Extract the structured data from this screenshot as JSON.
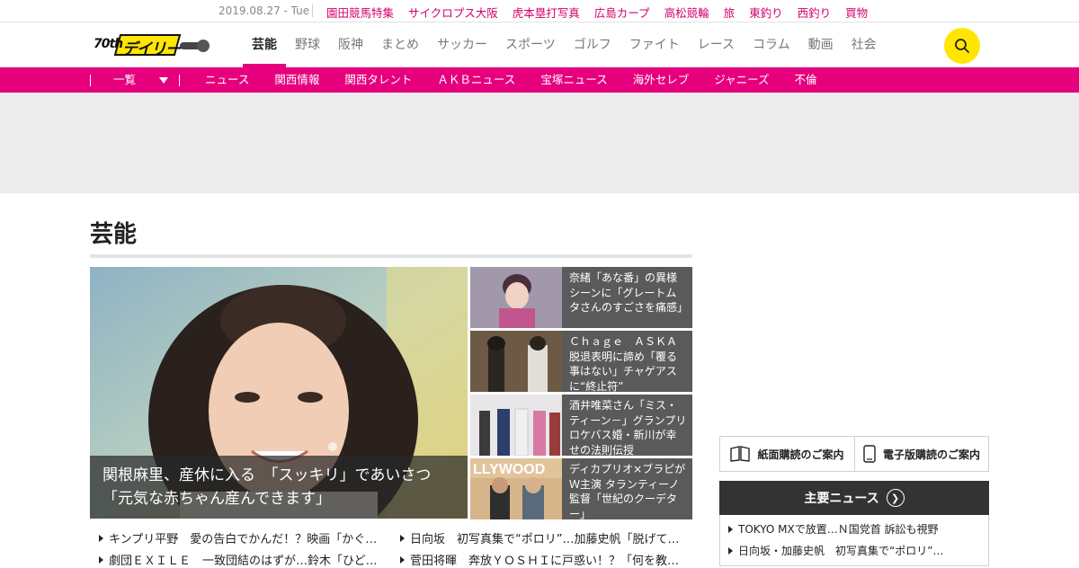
{
  "topbar": {
    "date": "2019.08.27 - Tue",
    "links": [
      "園田競馬特集",
      "サイクロプス大阪",
      "虎本塁打写真",
      "広島カープ",
      "高松競輪",
      "旅",
      "東釣り",
      "西釣り",
      "買物"
    ]
  },
  "header": {
    "logo_text": "デイリー",
    "logo_badge": "70th",
    "nav": [
      "芸能",
      "野球",
      "阪神",
      "まとめ",
      "サッカー",
      "スポーツ",
      "ゴルフ",
      "ファイト",
      "レース",
      "コラム",
      "動画",
      "社会"
    ],
    "active_nav": "芸能"
  },
  "subnav": {
    "list_label": "一覧",
    "links": [
      "ニュース",
      "関西情報",
      "関西タレント",
      "ＡＫＢニュース",
      "宝塚ニュース",
      "海外セレブ",
      "ジャニーズ",
      "不倫"
    ]
  },
  "page": {
    "title": "芸能"
  },
  "hero": {
    "caption": "関根麻里、産休に入る　「スッキリ」であいさつ「元気な赤ちゃん産んできます」"
  },
  "side_stories": [
    {
      "text": "奈緒「あな番」の異様シーンに「グレートムタさんのすごさを痛感」"
    },
    {
      "text": "Ｃｈａｇｅ　ＡＳＫＡ脱退表明に諦め「覆る事はない」チャゲアスに“終止符”"
    },
    {
      "text": "酒井唯菜さん「ミス・ティーン－」グランプリ ロケバス婚・新川が幸せの法則伝授"
    },
    {
      "text": "ディカプリオ×ブラピがＷ主演 タランティーノ監督「世紀のクーデター」"
    }
  ],
  "bottom_links": [
    "キンプリ平野　愛の告白でかんだ！？映画「かぐ…",
    "日向坂　初写真集で“ポロリ”…加藤史帆「脱げて…",
    "劇団ＥＸＩＬＥ　一致団結のはずが…鈴木「ひど…",
    "菅田将暉　奔放ＹＯＳＨＩに戸惑い！？「何を教…"
  ],
  "sidebar": {
    "paper_sub": "紙面購読のご案内",
    "digital_sub": "電子版購読のご案内",
    "major_title": "主要ニュース",
    "major_items": [
      "TOKYO MXで放置…Ｎ国党首 訴訟も視野",
      "日向坂・加藤史帆　初写真集で“ポロリ”…"
    ]
  },
  "colors": {
    "accent": "#e6007e",
    "search": "#ffe600"
  },
  "icons": [
    "search-icon",
    "chevron-down-icon",
    "newspaper-icon",
    "tablet-icon",
    "chevron-right-icon"
  ]
}
